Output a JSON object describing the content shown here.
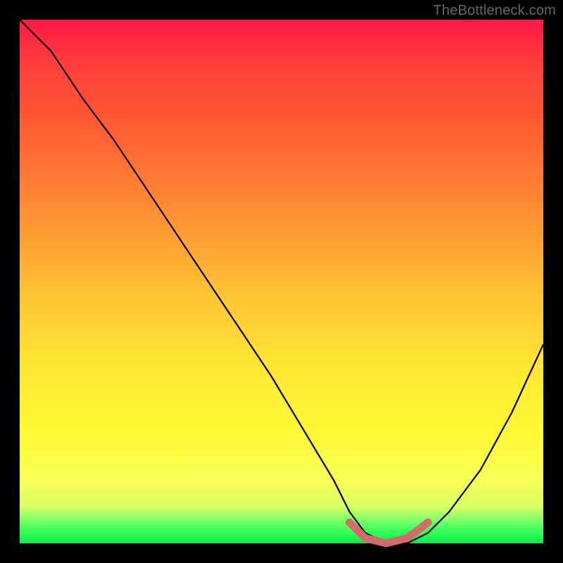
{
  "watermark": "TheBottleneck.com",
  "chart_data": {
    "type": "line",
    "title": "",
    "xlabel": "",
    "ylabel": "",
    "xlim": [
      0,
      100
    ],
    "ylim": [
      0,
      100
    ],
    "series": [
      {
        "name": "bottleneck-curve",
        "x": [
          0,
          6,
          12,
          18,
          24,
          30,
          36,
          42,
          48,
          54,
          60,
          63,
          66,
          70,
          74,
          78,
          82,
          88,
          94,
          100
        ],
        "values": [
          100,
          94,
          85,
          77,
          68,
          59,
          50,
          41,
          32,
          22,
          12,
          6,
          2,
          0,
          0,
          2,
          6,
          14,
          25,
          38
        ]
      },
      {
        "name": "optimal-range-highlight",
        "x": [
          63,
          66,
          70,
          74,
          78
        ],
        "values": [
          4,
          1,
          0,
          1,
          4
        ]
      }
    ],
    "colors": {
      "curve": "#000000",
      "highlight": "#d46a6a"
    },
    "annotations": []
  }
}
